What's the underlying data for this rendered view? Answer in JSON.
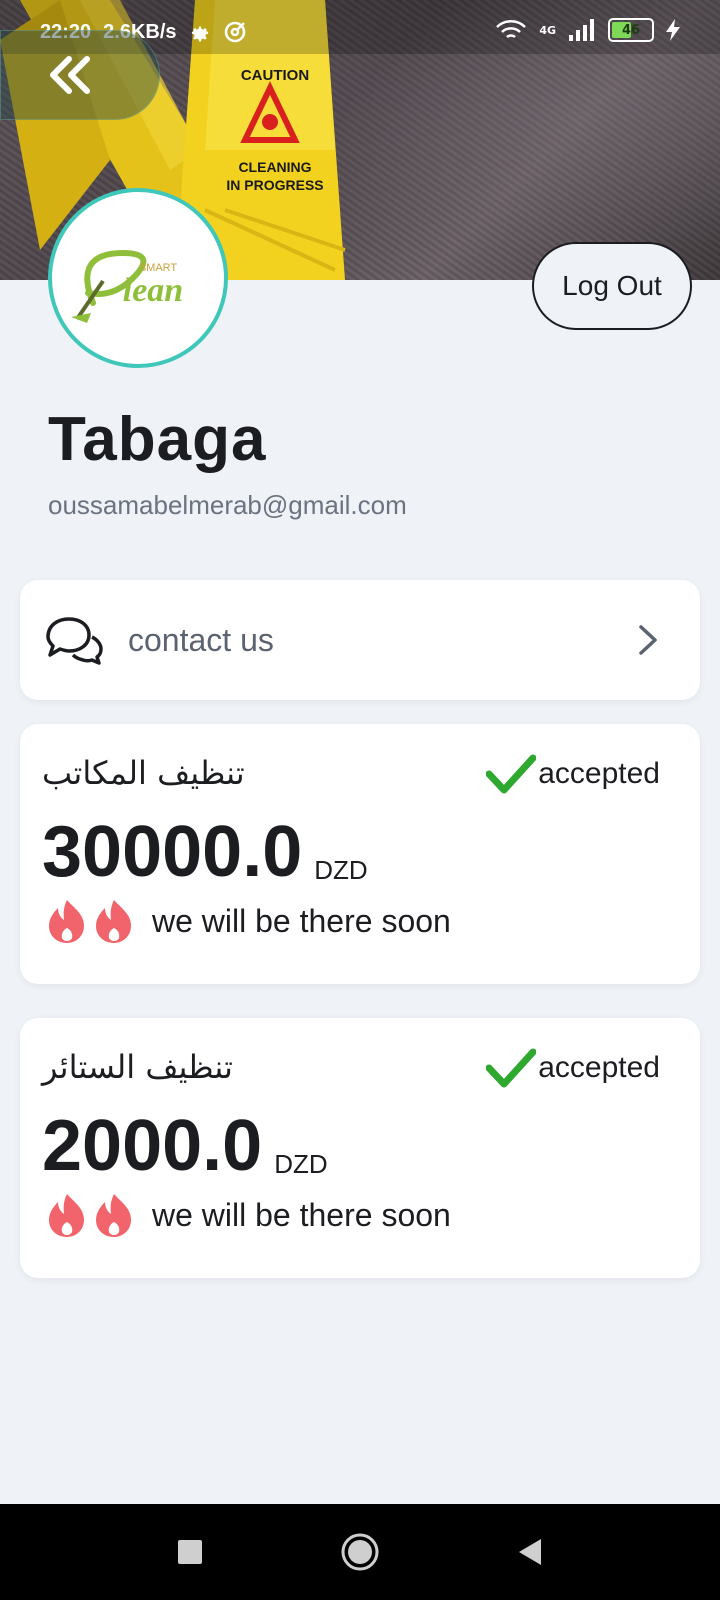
{
  "status_bar": {
    "time": "22:20",
    "speed": "2.6KB/s",
    "network": "4G",
    "battery": "46"
  },
  "profile": {
    "name": "Tabaga",
    "email": "oussamabelmerab@gmail.com",
    "logo_text": "SMART Clean"
  },
  "actions": {
    "logout_label": "Log Out",
    "contact_label": "contact us"
  },
  "orders": [
    {
      "title": "تنظيف المكاتب",
      "status": "accepted",
      "price": "30000.0",
      "currency": "DZD",
      "message": "we will be there soon"
    },
    {
      "title": "تنظيف الستائر",
      "status": "accepted",
      "price": "2000.0",
      "currency": "DZD",
      "message": "we will be there soon"
    }
  ],
  "colors": {
    "accent": "#3fc7ba",
    "check": "#2ea82e",
    "flame": "#f2646b",
    "background": "#eff2f7"
  },
  "icons": {
    "back": "double-chevron-left-icon",
    "contact": "chat-bubbles-icon",
    "arrow": "chevron-right-icon",
    "status": "check-icon",
    "flame": "flame-icon"
  }
}
